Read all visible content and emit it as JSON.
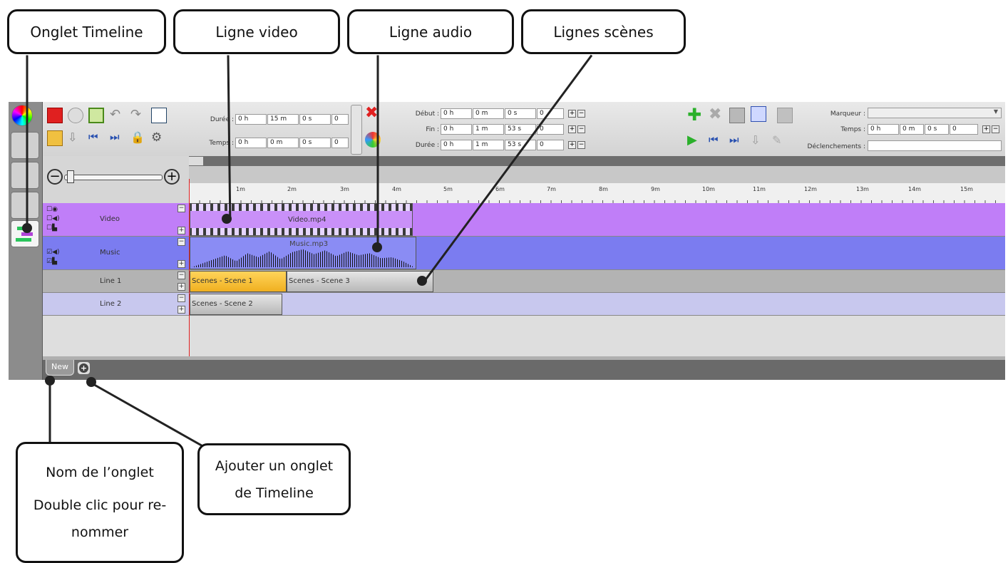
{
  "callouts": {
    "timeline_tab": "Onglet Timeline",
    "video_line": "Ligne video",
    "audio_line": "Ligne audio",
    "scene_lines": "Lignes scènes",
    "tab_name_line1": "Nom de l’onglet",
    "tab_name_line2": "Double clic pour re-",
    "tab_name_line3": "nommer",
    "add_tab_line1": "Ajouter un onglet",
    "add_tab_line2": "de Timeline"
  },
  "toolbar": {
    "duree_label": "Durée :",
    "temps_label": "Temps :",
    "duree_values": [
      "0 h",
      "15 m",
      "0 s",
      "0"
    ],
    "temps_values": [
      "0 h",
      "0 m",
      "0 s",
      "0"
    ],
    "debut_label": "Début :",
    "fin_label": "Fin :",
    "clip_duree_label": "Durée :",
    "debut_values": [
      "0 h",
      "0 m",
      "0 s",
      "0"
    ],
    "fin_values": [
      "0 h",
      "1 m",
      "53 s",
      "0"
    ],
    "clip_duree_values": [
      "0 h",
      "1 m",
      "53 s",
      "0"
    ],
    "marqueur_label": "Marqueur :",
    "marker_temps_label": "Temps :",
    "marker_temps_values": [
      "0 h",
      "0 m",
      "0 s",
      "0"
    ],
    "declenchements_label": "Déclenchements :"
  },
  "ruler": [
    "1m",
    "2m",
    "3m",
    "4m",
    "5m",
    "6m",
    "7m",
    "8m",
    "9m",
    "10m",
    "11m",
    "12m",
    "13m",
    "14m",
    "15m"
  ],
  "tracks": {
    "video": {
      "name": "Video",
      "clip": "Video.mp4",
      "color": "#c07ef8"
    },
    "music": {
      "name": "Music",
      "clip": "Music.mp3",
      "color": "#7b7cf0"
    },
    "line1": {
      "name": "Line 1",
      "clip_a": "Scenes - Scene 1",
      "clip_b": "Scenes - Scene 3"
    },
    "line2": {
      "name": "Line 2",
      "clip_a": "Scenes - Scene 2"
    }
  },
  "tabs": {
    "active": "New",
    "add_symbol": "+"
  }
}
